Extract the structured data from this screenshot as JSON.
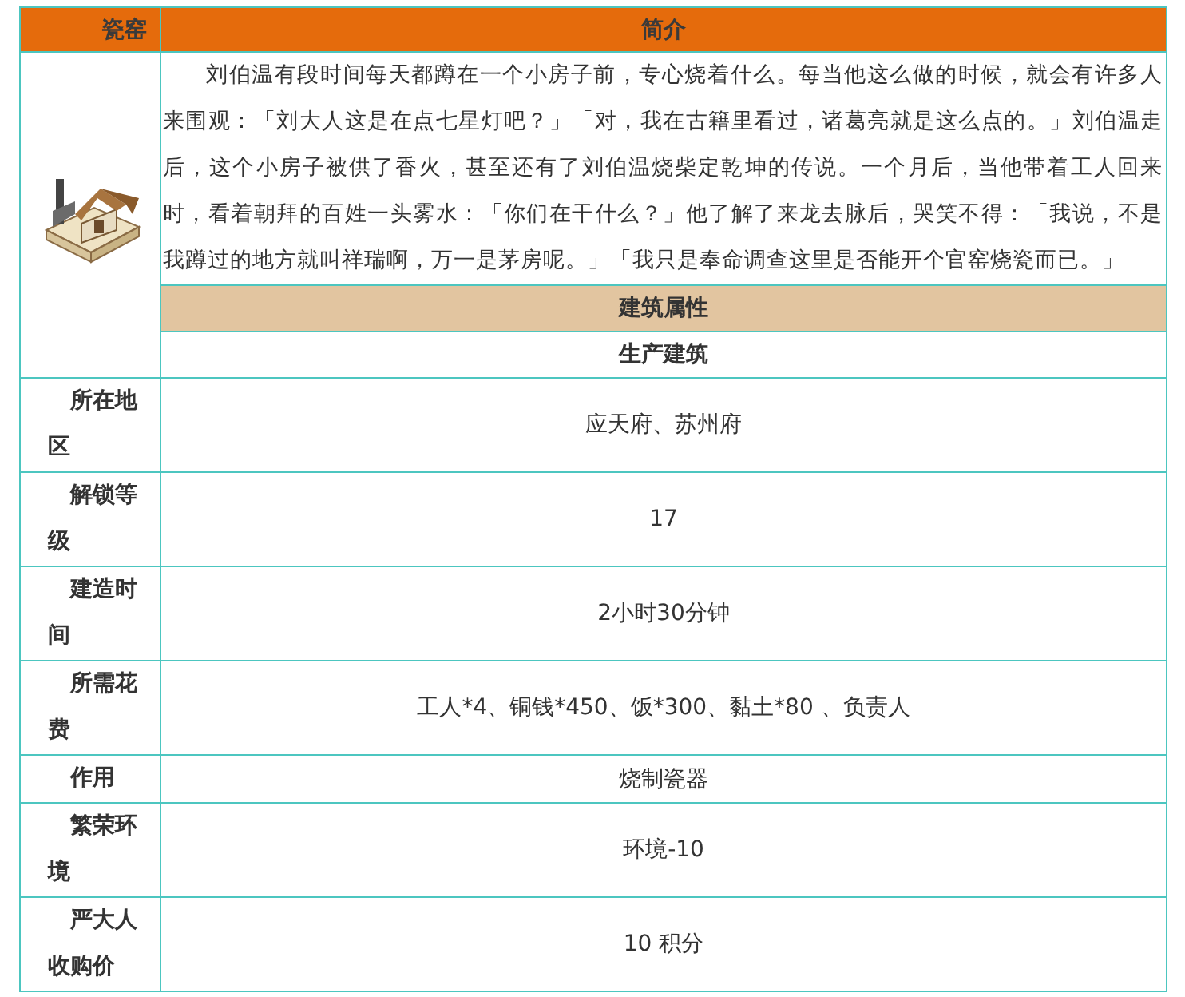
{
  "table": {
    "columns": [
      "瓷窑",
      "简介"
    ],
    "description": "刘伯温有段时间每天都蹲在一个小房子前，专心烧着什么。每当他这么做的时候，就会有许多人来围观：「刘大人这是在点七星灯吧？」「对，我在古籍里看过，诸葛亮就是这么点的。」刘伯温走后，这个小房子被供了香火，甚至还有了刘伯温烧柴定乾坤的传说。一个月后，当他带着工人回来时，看着朝拜的百姓一头雾水：「你们在干什么？」他了解了来龙去脉后，哭笑不得：「我说，不是我蹲过的地方就叫祥瑞啊，万一是茅房呢。」「我只是奉命调查这里是否能开个官窑烧瓷而已。」",
    "section_header": "建筑属性",
    "category": "生产建筑",
    "rows": [
      {
        "label": "所在地区",
        "value": "应天府、苏州府"
      },
      {
        "label": "解锁等级",
        "value": "17"
      },
      {
        "label": "建造时间",
        "value": "2小时30分钟"
      },
      {
        "label": "所需花费",
        "value": "工人*4、铜钱*450、饭*300、黏土*80 、负责人"
      },
      {
        "label": "作用",
        "value": "烧制瓷器"
      },
      {
        "label": "繁荣环境",
        "value": "环境-10"
      },
      {
        "label": "严大人收购价",
        "value": "10 积分"
      }
    ]
  }
}
